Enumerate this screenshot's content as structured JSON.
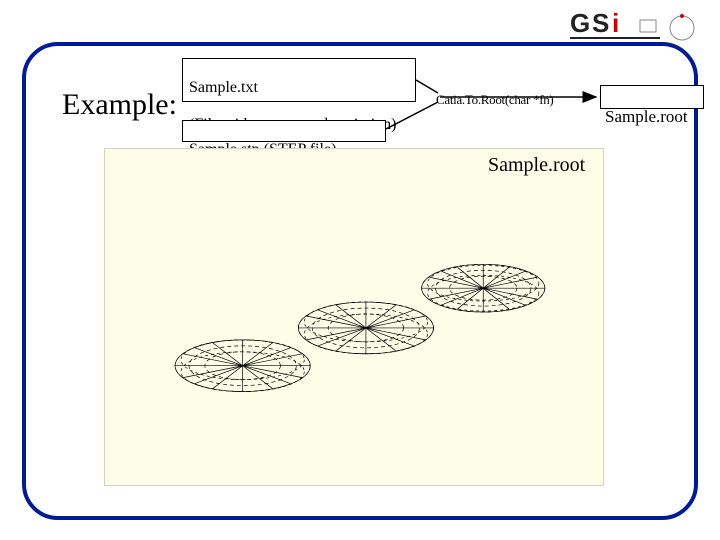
{
  "header_title": "Example:",
  "input_box": {
    "line1": "Sample.txt",
    "line2": "(File with geometry description)"
  },
  "step_box": "Sample.stp (STEP file)",
  "function_label": "Catia.To.Root(char *fn)",
  "output_box": "Sample.root",
  "viewer_title": "Sample.root",
  "logo_text": "GSI"
}
